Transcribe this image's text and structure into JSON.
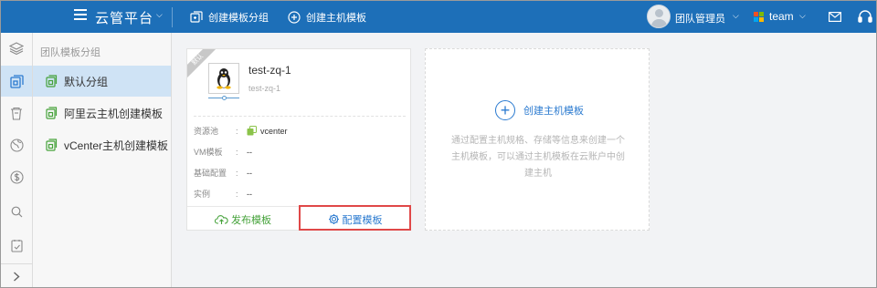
{
  "topbar": {
    "brand": "云管平台",
    "actions": [
      {
        "label": "创建模板分组",
        "icon": "template-group-icon"
      },
      {
        "label": "创建主机模板",
        "icon": "plus-circle-icon"
      }
    ],
    "user_name": "团队管理员",
    "team_name": "team",
    "bg_color": "#1d6fb8"
  },
  "rail": {
    "items": [
      "layers-icon",
      "template-icon",
      "trash-icon",
      "globe-icon",
      "dollar-icon",
      "search-icon",
      "checklist-icon"
    ],
    "active_index": 1,
    "collapse_icon": "chevron-right-icon"
  },
  "groups": {
    "header": "团队模板分组",
    "items": [
      {
        "label": "默认分组",
        "active": true
      },
      {
        "label": "阿里云主机创建模板",
        "active": false
      },
      {
        "label": "vCenter主机创建模板",
        "active": false
      }
    ]
  },
  "template_card": {
    "ribbon": "默认",
    "os_icon": "linux-tux-icon",
    "title": "test-zq-1",
    "subtitle": "test-zq-1",
    "fields": [
      {
        "key": "资源池",
        "value": "vcenter",
        "icon": "vcenter-icon"
      },
      {
        "key": "VM模板",
        "value": "--"
      },
      {
        "key": "基础配置",
        "value": "--"
      },
      {
        "key": "实例",
        "value": "--"
      }
    ],
    "publish_label": "发布模板",
    "configure_label": "配置模板"
  },
  "create_card": {
    "label": "创建主机模板",
    "description": "通过配置主机规格、存储等信息来创建一个主机模板，可以通过主机模板在云账户中创建主机"
  },
  "colors": {
    "accent": "#2c7bd0",
    "green": "#45a23a",
    "highlight": "#e04848",
    "selected_bg": "#cfe3f5"
  }
}
